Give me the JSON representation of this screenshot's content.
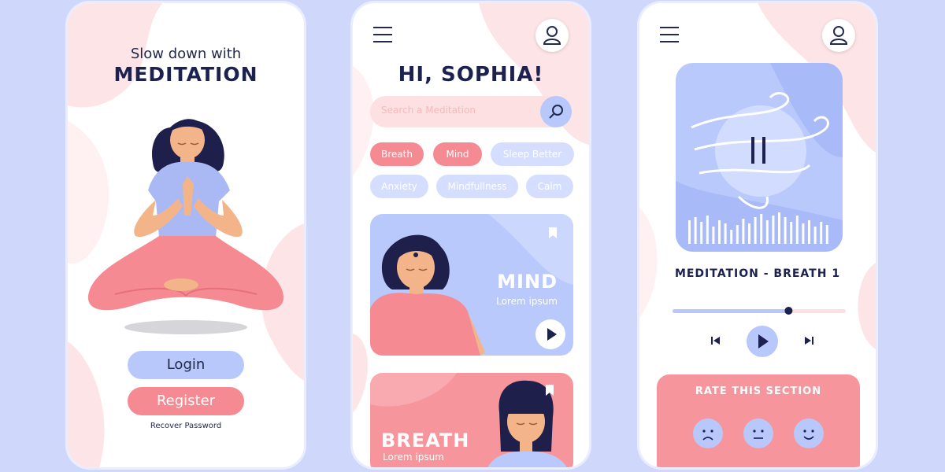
{
  "colors": {
    "background": "#cfd8fb",
    "pink": "#f58a92",
    "blue": "#b8c8fb",
    "navy": "#1c2150"
  },
  "welcome": {
    "subtitle": "Slow down with",
    "title": "MEDITATION",
    "login_label": "Login",
    "register_label": "Register",
    "recover_label": "Recover Password"
  },
  "home": {
    "greeting": "HI, SOPHIA!",
    "search_placeholder": "Search a Meditation",
    "chips": [
      "Breath",
      "Mind",
      "Sleep Better",
      "Anxiety",
      "Mindfullness",
      "Calm"
    ],
    "cards": [
      {
        "title": "MIND",
        "subtitle": "Lorem ipsum"
      },
      {
        "title": "BREATH",
        "subtitle": "Lorem ipsum"
      }
    ]
  },
  "player": {
    "track_title": "MEDITATION - BREATH 1",
    "progress": 0.67,
    "rate_title": "RATE THIS SECTION",
    "ratings": [
      "sad-face-icon",
      "neutral-face-icon",
      "happy-face-icon"
    ]
  }
}
